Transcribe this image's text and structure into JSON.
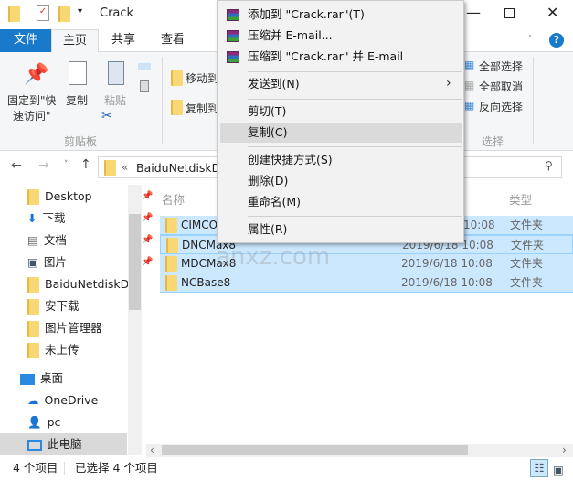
{
  "window": {
    "title": "Crack"
  },
  "ribbon_tabs": [
    "文件",
    "主页",
    "共享",
    "查看"
  ],
  "ribbon": {
    "pin_label_1": "固定到\"快",
    "pin_label_2": "速访问\"",
    "copy": "复制",
    "paste": "粘贴",
    "move_to": "移动到",
    "copy_to": "复制到",
    "group_clipboard": "剪贴板",
    "select_all": "全部选择",
    "select_none": "全部取消",
    "invert_selection": "反向选择",
    "group_select": "选择"
  },
  "address": {
    "path": "BaiduNetdiskD",
    "prefix": "«"
  },
  "nav": {
    "items": [
      {
        "label": "Desktop",
        "pinned": true
      },
      {
        "label": "下载",
        "pinned": true
      },
      {
        "label": "文档",
        "pinned": true
      },
      {
        "label": "图片",
        "pinned": true
      },
      {
        "label": "BaiduNetdiskD"
      },
      {
        "label": "安下载"
      },
      {
        "label": "图片管理器"
      },
      {
        "label": "未上传"
      },
      {
        "label": "桌面"
      },
      {
        "label": "OneDrive"
      },
      {
        "label": "pc"
      },
      {
        "label": "此电脑"
      }
    ]
  },
  "columns": {
    "name": "名称",
    "type": "类型"
  },
  "files": [
    {
      "name": "CIMCO",
      "date": "10:08",
      "type": "文件夹"
    },
    {
      "name": "DNCMax8",
      "date": "2019/6/18 10:08",
      "type": "文件夹"
    },
    {
      "name": "MDCMax8",
      "date": "2019/6/18 10:08",
      "type": "文件夹"
    },
    {
      "name": "NCBase8",
      "date": "2019/6/18 10:08",
      "type": "文件夹"
    }
  ],
  "context_menu": {
    "items": [
      "添加到 \"Crack.rar\"(T)",
      "压缩并 E-mail...",
      "压缩到 \"Crack.rar\" 并 E-mail",
      "发送到(N)",
      "剪切(T)",
      "复制(C)",
      "创建快捷方式(S)",
      "删除(D)",
      "重命名(M)",
      "属性(R)"
    ],
    "highlighted": "复制(C)"
  },
  "status": {
    "count": "4 个项目",
    "selected": "已选择 4 个项目"
  },
  "watermark": "安下载 anxz.com",
  "colors": {
    "accent": "#1979ca",
    "selection": "#cce8ff"
  }
}
